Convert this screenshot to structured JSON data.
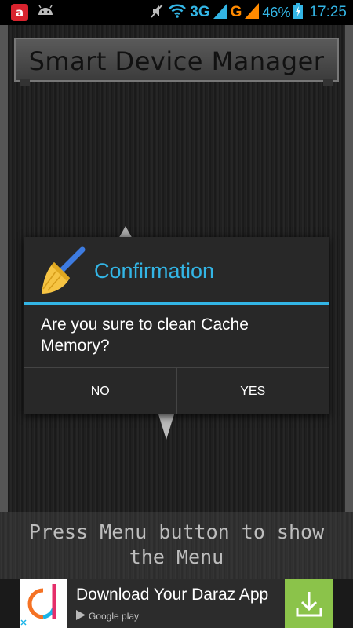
{
  "status_bar": {
    "notifications": [
      "avira-icon",
      "android-icon"
    ],
    "avira_glyph": "a",
    "network_3g": "3G",
    "network_g": "G",
    "battery": "46%",
    "time": "17:25",
    "colors": {
      "accent": "#33b5e5",
      "orange": "#ff8a00"
    }
  },
  "app": {
    "title": "Smart Device Manager"
  },
  "dialog": {
    "icon": "broom-icon",
    "title": "Confirmation",
    "message": "Are you sure to clean Cache Memory?",
    "buttons": {
      "no": "NO",
      "yes": "YES"
    },
    "accent": "#33b5e5"
  },
  "hint": {
    "line1": "Press Menu button to show",
    "line2": "the Menu"
  },
  "ad": {
    "title": "Download Your Daraz App",
    "store": "Google play",
    "download_color": "#8bc34a"
  }
}
